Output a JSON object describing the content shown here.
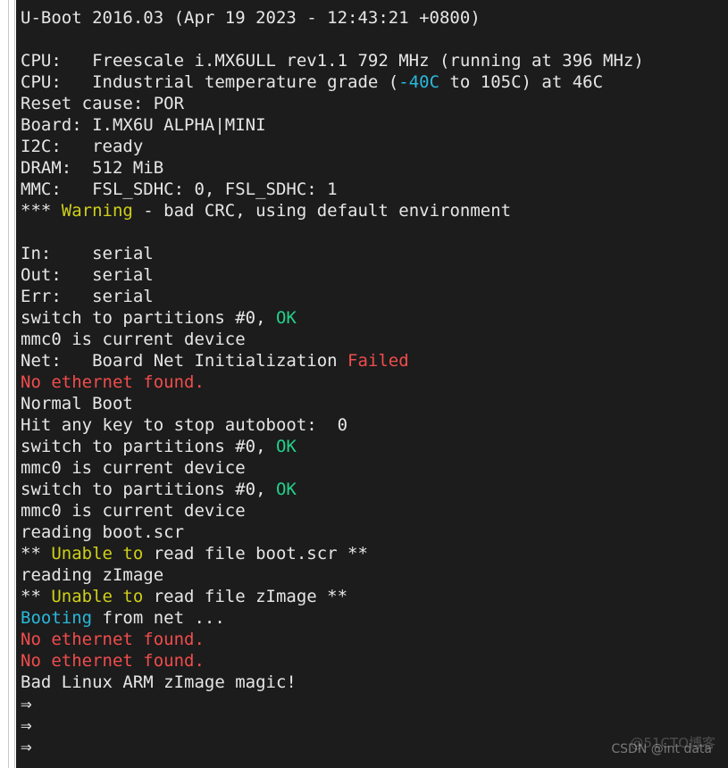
{
  "terminal": {
    "background_color": "#1c1c1c",
    "default_text_color": "#e6e6e6",
    "colors": {
      "white": "#e6e6e6",
      "cyan": "#29b8db",
      "green": "#23d18b",
      "yellow": "#cfcf1a",
      "red": "#f14c4c"
    },
    "prompt_symbol": "⇒",
    "lines": [
      {
        "segments": [
          {
            "text": "U-Boot 2016.03 (Apr 19 2023 - 12:43:21 +0800)",
            "color": "white"
          }
        ]
      },
      {
        "segments": [
          {
            "text": "",
            "color": "white"
          }
        ]
      },
      {
        "segments": [
          {
            "text": "CPU:   Freescale i.MX6ULL rev1.1 792 MHz (running at 396 MHz)",
            "color": "white"
          }
        ]
      },
      {
        "segments": [
          {
            "text": "CPU:   Industrial temperature grade (",
            "color": "white"
          },
          {
            "text": "-40C",
            "color": "cyan"
          },
          {
            "text": " to 105C) at 46C",
            "color": "white"
          }
        ]
      },
      {
        "segments": [
          {
            "text": "Reset cause: POR",
            "color": "white"
          }
        ]
      },
      {
        "segments": [
          {
            "text": "Board: I.MX6U ALPHA|MINI",
            "color": "white"
          }
        ]
      },
      {
        "segments": [
          {
            "text": "I2C:   ready",
            "color": "white"
          }
        ]
      },
      {
        "segments": [
          {
            "text": "DRAM:  512 MiB",
            "color": "white"
          }
        ]
      },
      {
        "segments": [
          {
            "text": "MMC:   FSL_SDHC: 0, FSL_SDHC: 1",
            "color": "white"
          }
        ]
      },
      {
        "segments": [
          {
            "text": "*** ",
            "color": "white"
          },
          {
            "text": "Warning",
            "color": "yellow"
          },
          {
            "text": " - bad CRC, using default environment",
            "color": "white"
          }
        ]
      },
      {
        "segments": [
          {
            "text": "",
            "color": "white"
          }
        ]
      },
      {
        "segments": [
          {
            "text": "In:    serial",
            "color": "white"
          }
        ]
      },
      {
        "segments": [
          {
            "text": "Out:   serial",
            "color": "white"
          }
        ]
      },
      {
        "segments": [
          {
            "text": "Err:   serial",
            "color": "white"
          }
        ]
      },
      {
        "segments": [
          {
            "text": "switch to partitions #0, ",
            "color": "white"
          },
          {
            "text": "OK",
            "color": "green"
          }
        ]
      },
      {
        "segments": [
          {
            "text": "mmc0 is current device",
            "color": "white"
          }
        ]
      },
      {
        "segments": [
          {
            "text": "Net:   Board Net Initialization ",
            "color": "white"
          },
          {
            "text": "Failed",
            "color": "red"
          }
        ]
      },
      {
        "segments": [
          {
            "text": "No ethernet found.",
            "color": "red"
          }
        ]
      },
      {
        "segments": [
          {
            "text": "Normal Boot",
            "color": "white"
          }
        ]
      },
      {
        "segments": [
          {
            "text": "Hit any key to stop autoboot:  0",
            "color": "white"
          }
        ]
      },
      {
        "segments": [
          {
            "text": "switch to partitions #0, ",
            "color": "white"
          },
          {
            "text": "OK",
            "color": "green"
          }
        ]
      },
      {
        "segments": [
          {
            "text": "mmc0 is current device",
            "color": "white"
          }
        ]
      },
      {
        "segments": [
          {
            "text": "switch to partitions #0, ",
            "color": "white"
          },
          {
            "text": "OK",
            "color": "green"
          }
        ]
      },
      {
        "segments": [
          {
            "text": "mmc0 is current device",
            "color": "white"
          }
        ]
      },
      {
        "segments": [
          {
            "text": "reading boot.scr",
            "color": "white"
          }
        ]
      },
      {
        "segments": [
          {
            "text": "** ",
            "color": "white"
          },
          {
            "text": "Unable to",
            "color": "yellow"
          },
          {
            "text": " read file boot.scr **",
            "color": "white"
          }
        ]
      },
      {
        "segments": [
          {
            "text": "reading zImage",
            "color": "white"
          }
        ]
      },
      {
        "segments": [
          {
            "text": "** ",
            "color": "white"
          },
          {
            "text": "Unable to",
            "color": "yellow"
          },
          {
            "text": " read file zImage **",
            "color": "white"
          }
        ]
      },
      {
        "segments": [
          {
            "text": "Booting",
            "color": "cyan"
          },
          {
            "text": " from net ...",
            "color": "white"
          }
        ]
      },
      {
        "segments": [
          {
            "text": "No ethernet found.",
            "color": "red"
          }
        ]
      },
      {
        "segments": [
          {
            "text": "No ethernet found.",
            "color": "red"
          }
        ]
      },
      {
        "segments": [
          {
            "text": "Bad Linux ARM zImage magic!",
            "color": "white"
          }
        ]
      },
      {
        "segments": [
          {
            "text": "⇒ ",
            "color": "white"
          }
        ]
      },
      {
        "segments": [
          {
            "text": "⇒ ",
            "color": "white"
          }
        ]
      },
      {
        "segments": [
          {
            "text": "⇒ ",
            "color": "white"
          }
        ]
      }
    ]
  },
  "gutter": {
    "visible_line_marks": [
      "0",
      "0",
      "0",
      "0",
      "0",
      "0",
      "0",
      "0",
      "0",
      "0",
      "0",
      "0",
      "0",
      "0",
      "0",
      "0"
    ]
  },
  "watermark": {
    "cn_text": "@51CTO博客",
    "en_text": "CSDN @int data"
  }
}
